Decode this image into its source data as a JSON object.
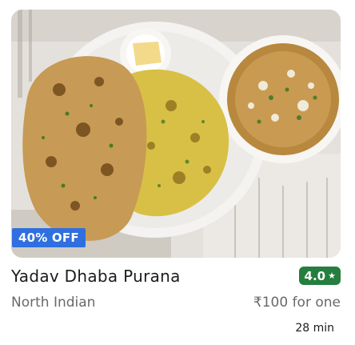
{
  "restaurant": {
    "name": "Yadav Dhaba Purana",
    "rating": "4.0",
    "rating_icon": "star-icon",
    "cuisine": "North Indian",
    "price": "₹100 for one",
    "delivery_time": "28 min",
    "discount": "40% OFF",
    "image_subject": "photo of naan breads with butter and a bowl of dal"
  },
  "colors": {
    "discount_badge": "#2f6fe0",
    "rating_badge": "#257e3e",
    "secondary_text": "#696969",
    "primary_text": "#1c1c1c"
  }
}
